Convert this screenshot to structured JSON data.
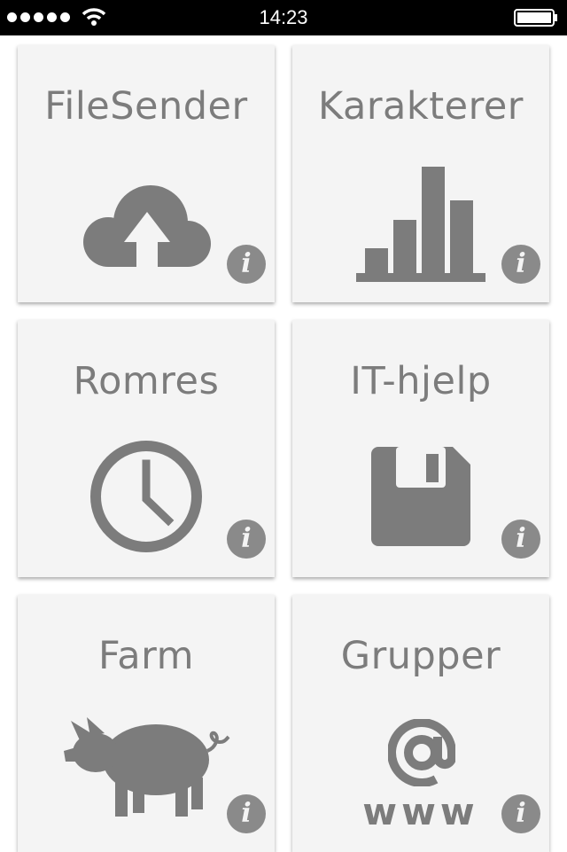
{
  "status_bar": {
    "time": "14:23"
  },
  "tiles": [
    {
      "title": "FileSender",
      "icon": "cloud-upload-icon",
      "info": "i"
    },
    {
      "title": "Karakterer",
      "icon": "bar-chart-icon",
      "info": "i"
    },
    {
      "title": "Romres",
      "icon": "clock-icon",
      "info": "i"
    },
    {
      "title": "IT-hjelp",
      "icon": "floppy-disk-icon",
      "info": "i"
    },
    {
      "title": "Farm",
      "icon": "pig-icon",
      "info": "i"
    },
    {
      "title": "Grupper",
      "icon": "at-www-icon",
      "info": "i",
      "icon_text": "www"
    }
  ],
  "colors": {
    "tile_bg": "#f4f4f4",
    "icon": "#7c7c7c",
    "status_bar": "#000000"
  }
}
